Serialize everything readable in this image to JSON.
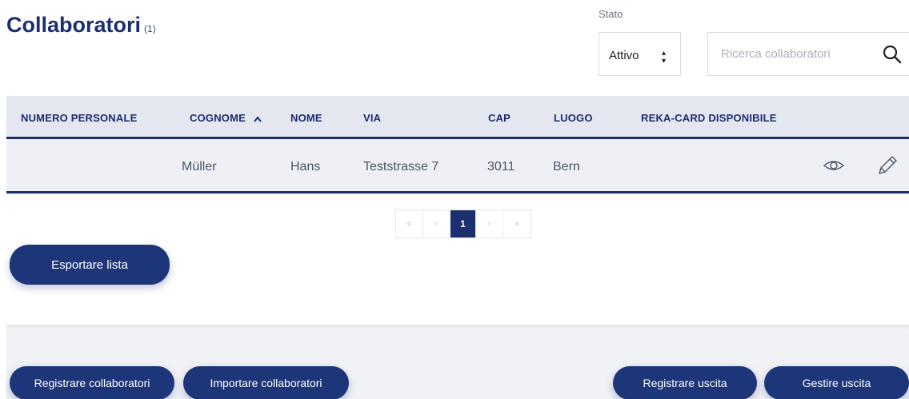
{
  "header": {
    "title": "Collaboratori",
    "count": "(1)"
  },
  "filters": {
    "stato_label": "Stato",
    "stato_value": "Attivo",
    "search_placeholder": "Ricerca collaboratori"
  },
  "table": {
    "columns": [
      "NUMERO PERSONALE",
      "COGNOME",
      "NOME",
      "VIA",
      "CAP",
      "LUOGO",
      "REKA-CARD DISPONIBILE"
    ],
    "sort_column": "COGNOME",
    "rows": [
      {
        "numero_personale": "",
        "cognome": "Müller",
        "nome": "Hans",
        "via": "Teststrasse 7",
        "cap": "3011",
        "luogo": "Bern",
        "reka_card": ""
      }
    ]
  },
  "pagination": {
    "first": "«",
    "prev": "‹",
    "current": "1",
    "next": "›",
    "last": "»"
  },
  "actions": {
    "export": "Esportare lista",
    "register": "Registrare collaboratori",
    "import": "Importare collaboratori",
    "register_exit": "Registrare uscita",
    "manage_exit": "Gestire uscita"
  },
  "colors": {
    "primary": "#1d3679",
    "header_bg": "#e4e6f0",
    "row_bg": "#eef0f5"
  },
  "icons": {
    "search": "search-icon",
    "sort": "chevron-up-icon",
    "view": "eye-icon",
    "edit": "pencil-icon"
  }
}
